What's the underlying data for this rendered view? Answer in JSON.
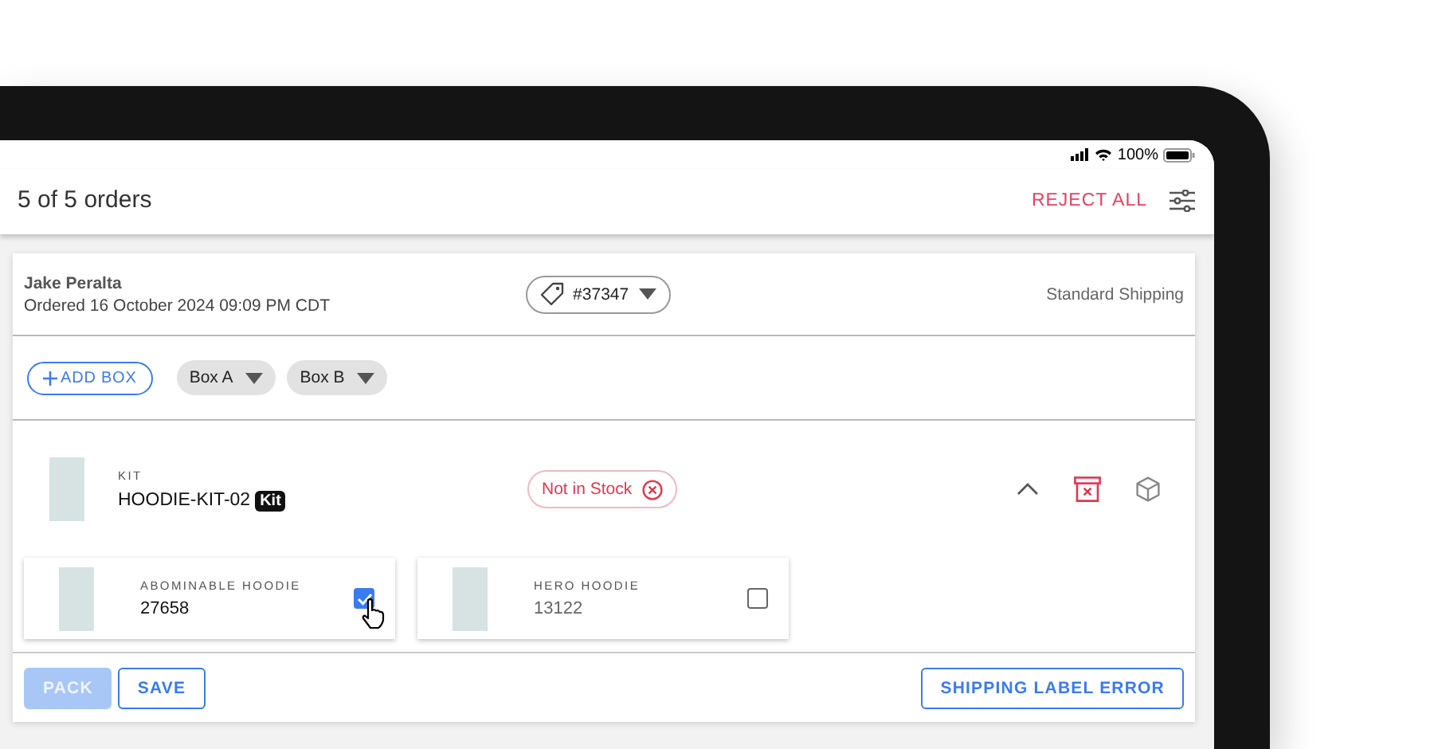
{
  "status_bar": {
    "battery": "100%"
  },
  "header": {
    "title": "5 of 5 orders",
    "reject_button": "REJECT ALL"
  },
  "order": {
    "customer": "Jake Peralta",
    "ordered": "Ordered 16 October 2024 09:09 PM CDT",
    "order_number": "#37347",
    "shipping": "Standard Shipping",
    "add_box_button": "ADD BOX",
    "boxes": [
      {
        "label": "Box A"
      },
      {
        "label": "Box B"
      }
    ],
    "kit": {
      "type_label": "KIT",
      "sku": "HOODIE-KIT-02",
      "badge": "Kit",
      "status": "Not in Stock",
      "expanded": true,
      "products": [
        {
          "name": "ABOMINABLE HOODIE",
          "sku": "27658",
          "checked": true
        },
        {
          "name": "HERO HOODIE",
          "sku": "13122",
          "checked": false
        }
      ]
    },
    "actions": [
      {
        "label": "PACK",
        "disabled": true
      },
      {
        "label": "SAVE",
        "disabled": false
      }
    ],
    "error_button": "SHIPPING LABEL ERROR"
  }
}
